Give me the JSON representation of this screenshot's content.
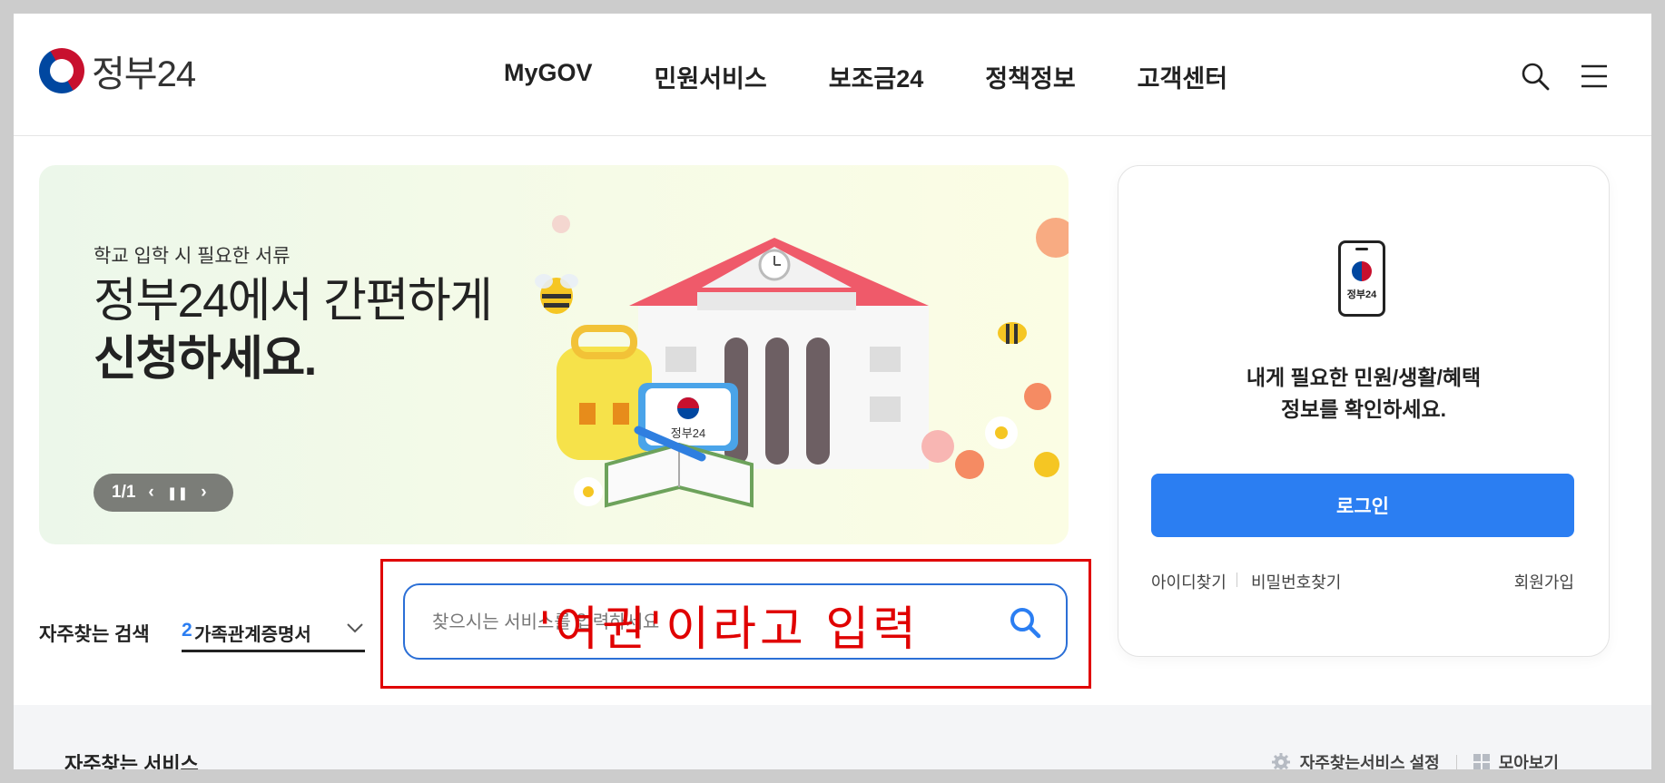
{
  "header": {
    "logo_text": "정부24",
    "nav": [
      "MyGOV",
      "민원서비스",
      "보조금24",
      "정책정보",
      "고객센터"
    ],
    "icons": [
      "search-icon",
      "menu-icon"
    ]
  },
  "banner": {
    "subtitle": "학교 입학 시 필요한 서류",
    "headline_line1": "정부24에서 간편하게",
    "headline_line2": "신청하세요.",
    "pager_text": "1/1",
    "illustration_sign": "정부24"
  },
  "login": {
    "device_label": "정부24",
    "message_line1": "내게 필요한 민원/생활/혜택",
    "message_line2": "정보를 확인하세요.",
    "button_label": "로그인",
    "find_id": "아이디찾기",
    "find_pw": "비밀번호찾기",
    "signup": "회원가입"
  },
  "frequent_search": {
    "label": "자주찾는 검색",
    "selected_rank": "2",
    "selected_text": "가족관계증명서"
  },
  "search": {
    "placeholder": "찾으시는 서비스를 입력하세요"
  },
  "annotation": {
    "text": "'여권'이라고 입력",
    "color": "#e00000"
  },
  "bottom": {
    "title": "자주찾는 서비스",
    "settings_label": "자주찾는서비스 설정",
    "gather_label": "모아보기"
  },
  "colors": {
    "accent": "#2b7ef2",
    "search_border": "#2b6fd6",
    "annotation": "#e00000"
  }
}
